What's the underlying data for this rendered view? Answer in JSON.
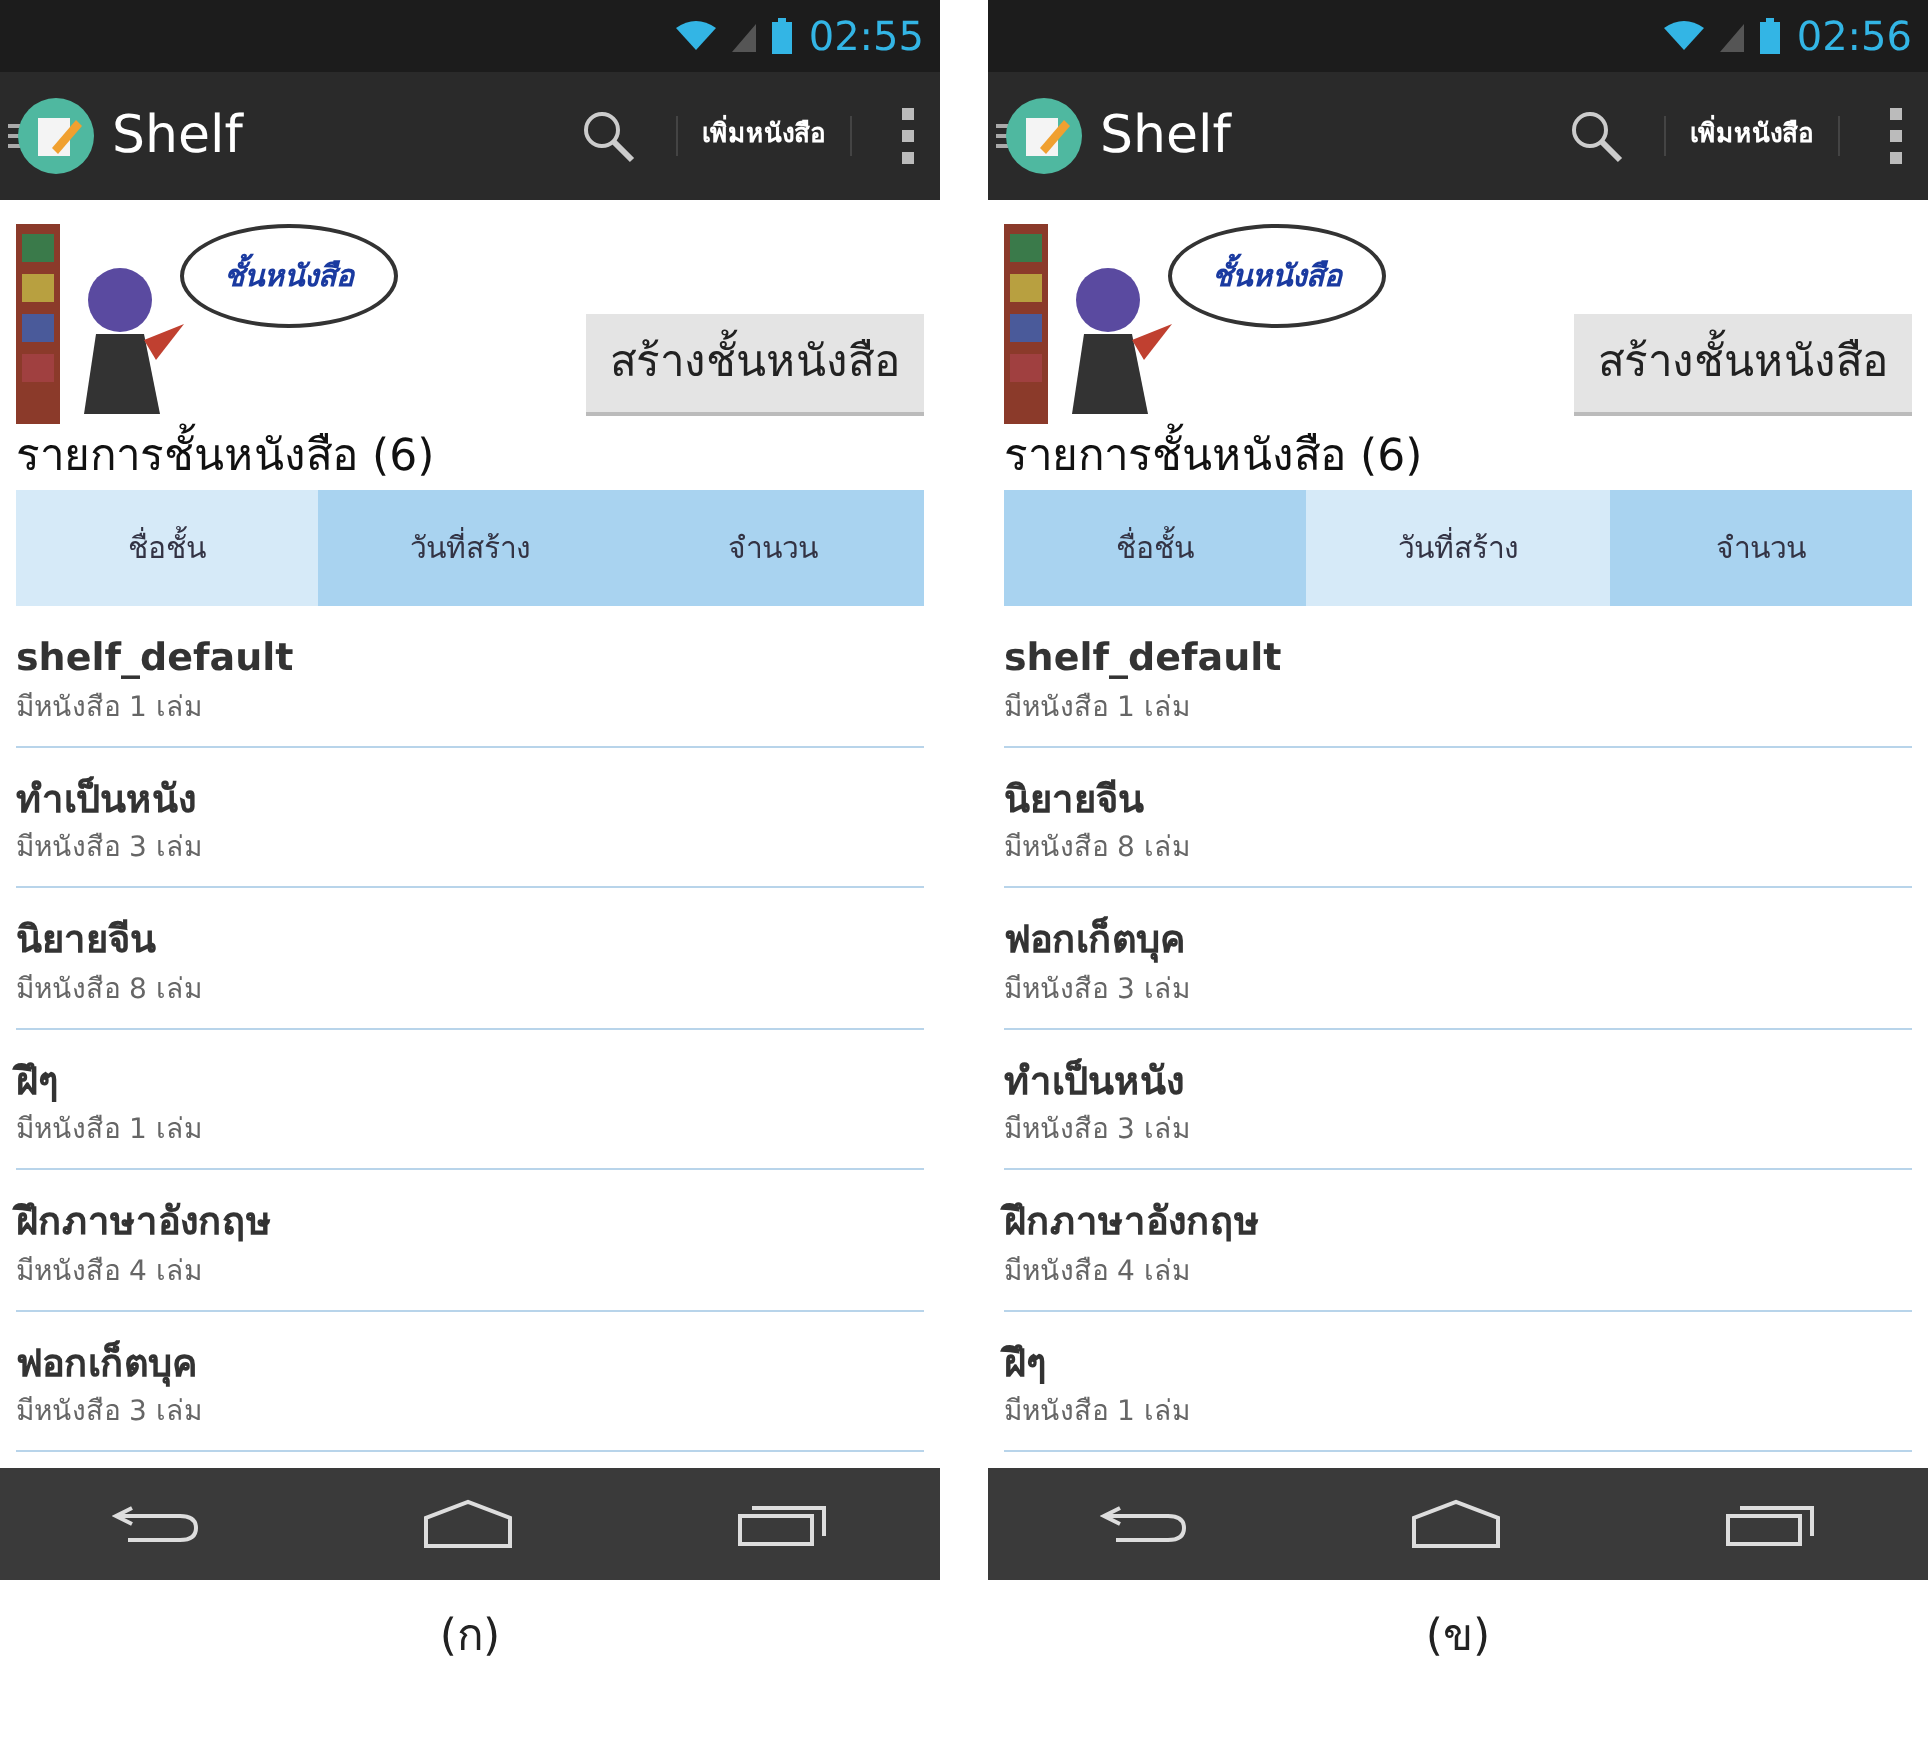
{
  "screens": [
    {
      "status_time": "02:55",
      "app_title": "Shelf",
      "action_label": "เพิ่มหนังสือ",
      "bubble_text": "ชั้นหนังสือ",
      "create_button": "สร้างชั้นหนังสือ",
      "list_title": "รายการชั้นหนังสือ (6)",
      "tabs": [
        {
          "label": "ชื่อชั้น",
          "selected": true
        },
        {
          "label": "วันที่สร้าง",
          "selected": false
        },
        {
          "label": "จำนวน",
          "selected": false
        }
      ],
      "items": [
        {
          "name": "shelf_default",
          "count": "มีหนังสือ 1 เล่ม"
        },
        {
          "name": "ทำเป็นหนัง",
          "count": "มีหนังสือ 3 เล่ม"
        },
        {
          "name": "นิยายจีน",
          "count": "มีหนังสือ 8 เล่ม"
        },
        {
          "name": "ฝึๆ",
          "count": "มีหนังสือ 1 เล่ม"
        },
        {
          "name": "ฝึกภาษาอังกฤษ",
          "count": "มีหนังสือ 4 เล่ม"
        },
        {
          "name": "ฟอกเก็ตบุค",
          "count": "มีหนังสือ 3 เล่ม"
        }
      ],
      "caption": "(ก)"
    },
    {
      "status_time": "02:56",
      "app_title": "Shelf",
      "action_label": "เพิ่มหนังสือ",
      "bubble_text": "ชั้นหนังสือ",
      "create_button": "สร้างชั้นหนังสือ",
      "list_title": "รายการชั้นหนังสือ (6)",
      "tabs": [
        {
          "label": "ชื่อชั้น",
          "selected": false
        },
        {
          "label": "วันที่สร้าง",
          "selected": true
        },
        {
          "label": "จำนวน",
          "selected": false
        }
      ],
      "items": [
        {
          "name": "shelf_default",
          "count": "มีหนังสือ 1 เล่ม"
        },
        {
          "name": "นิยายจีน",
          "count": "มีหนังสือ 8 เล่ม"
        },
        {
          "name": "ฟอกเก็ตบุค",
          "count": "มีหนังสือ 3 เล่ม"
        },
        {
          "name": "ทำเป็นหนัง",
          "count": "มีหนังสือ 3 เล่ม"
        },
        {
          "name": "ฝึกภาษาอังกฤษ",
          "count": "มีหนังสือ 4 เล่ม"
        },
        {
          "name": "ฝึๆ",
          "count": "มีหนังสือ 1 เล่ม"
        }
      ],
      "caption": "(ข)"
    }
  ]
}
